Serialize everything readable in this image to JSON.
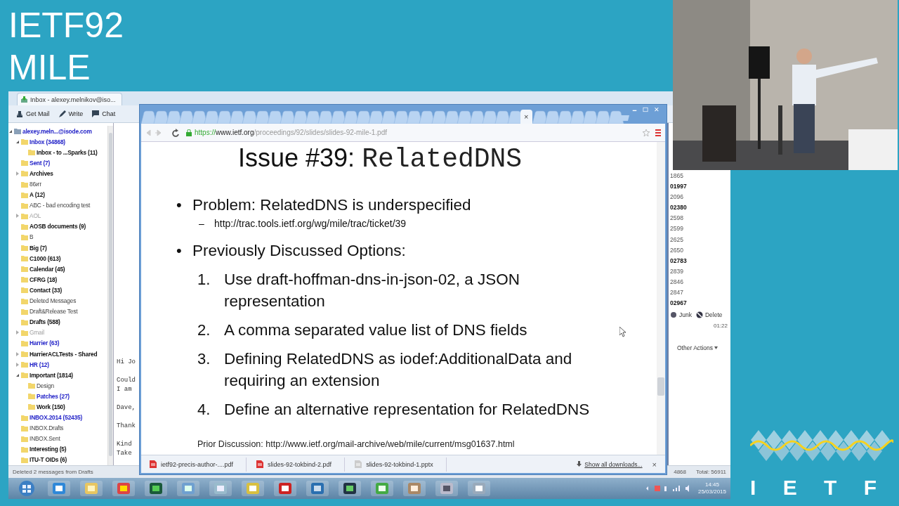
{
  "title_lines": [
    "IETF92",
    "MILE"
  ],
  "mail": {
    "tab_title": "Inbox - alexey.melnikov@iso...",
    "toolbar": [
      {
        "kind": "getmail",
        "label": "Get Mail"
      },
      {
        "kind": "write",
        "label": "Write"
      },
      {
        "kind": "chat",
        "label": "Chat"
      }
    ],
    "folders": [
      {
        "label": "alexey.meln...@isode.com",
        "unread": true,
        "new": true,
        "dimmed": false,
        "expanded": true,
        "children": [
          {
            "label": "Inbox (34868)",
            "unread": true,
            "new": true,
            "dimmed": false,
            "expanded": true,
            "children": [
              {
                "label": "Inbox - to ...Sparks (11)",
                "unread": true,
                "new": false,
                "dimmed": false
              }
            ]
          },
          {
            "label": "Sent (7)",
            "unread": true,
            "new": true,
            "dimmed": false
          },
          {
            "label": "Archives",
            "unread": true,
            "new": false,
            "dimmed": false,
            "expanded": false
          },
          {
            "label": "86ит",
            "unread": false,
            "new": false,
            "dimmed": false
          },
          {
            "label": "A (12)",
            "unread": true,
            "new": false,
            "dimmed": false
          },
          {
            "label": "ABC - bad encoding test",
            "unread": false,
            "new": false,
            "dimmed": false
          },
          {
            "label": "AOL",
            "unread": false,
            "new": false,
            "dimmed": true,
            "expanded": false
          },
          {
            "label": "AOSB documents (9)",
            "unread": true,
            "new": false,
            "dimmed": false
          },
          {
            "label": "B",
            "unread": false,
            "new": false,
            "dimmed": false
          },
          {
            "label": "Big (7)",
            "unread": true,
            "new": false,
            "dimmed": false
          },
          {
            "label": "C1000 (613)",
            "unread": true,
            "new": false,
            "dimmed": false
          },
          {
            "label": "Calendar (45)",
            "unread": true,
            "new": false,
            "dimmed": false
          },
          {
            "label": "CFRG (18)",
            "unread": true,
            "new": false,
            "dimmed": false
          },
          {
            "label": "Contact (33)",
            "unread": true,
            "new": false,
            "dimmed": false
          },
          {
            "label": "Deleted Messages",
            "unread": false,
            "new": false,
            "dimmed": false
          },
          {
            "label": "Draft&Release Test",
            "unread": false,
            "new": false,
            "dimmed": false
          },
          {
            "label": "Drafts (588)",
            "unread": true,
            "new": false,
            "dimmed": false
          },
          {
            "label": "Gmail",
            "unread": false,
            "new": false,
            "dimmed": true,
            "expanded": false
          },
          {
            "label": "Harrier (63)",
            "unread": true,
            "new": true,
            "dimmed": false
          },
          {
            "label": "HarrierACLTests - Shared",
            "unread": true,
            "new": false,
            "dimmed": false,
            "expanded": false
          },
          {
            "label": "HR (12)",
            "unread": true,
            "new": true,
            "dimmed": false,
            "expanded": false
          },
          {
            "label": "Important (1814)",
            "unread": true,
            "new": false,
            "dimmed": false,
            "expanded": true,
            "children": [
              {
                "label": "Design",
                "unread": false,
                "new": false,
                "dimmed": false
              },
              {
                "label": "Patches (27)",
                "unread": true,
                "new": true,
                "dimmed": false
              },
              {
                "label": "Work (150)",
                "unread": true,
                "new": false,
                "dimmed": false
              }
            ]
          },
          {
            "label": "INBOX.2014 (52435)",
            "unread": true,
            "new": true,
            "dimmed": false
          },
          {
            "label": "INBOX.Drafts",
            "unread": false,
            "new": false,
            "dimmed": false
          },
          {
            "label": "INBOX.Sent",
            "unread": false,
            "new": false,
            "dimmed": false
          },
          {
            "label": "Interesting (5)",
            "unread": true,
            "new": false,
            "dimmed": false
          },
          {
            "label": "ITU-T OIDs (6)",
            "unread": true,
            "new": false,
            "dimmed": false
          }
        ]
      }
    ],
    "preview": [
      [
        "Hi Jo"
      ],
      [
        "Could",
        "I am"
      ],
      [
        "Dave,"
      ],
      [
        "Thank"
      ],
      [
        "Kind",
        "Take"
      ]
    ],
    "messages": [
      {
        "text": "1865",
        "unread": false
      },
      {
        "text": "01997",
        "unread": true
      },
      {
        "text": "2096",
        "unread": false
      },
      {
        "text": "02380",
        "unread": true
      },
      {
        "text": "2598",
        "unread": false
      },
      {
        "text": "2599",
        "unread": false
      },
      {
        "text": "2625",
        "unread": false
      },
      {
        "text": "2650",
        "unread": false
      },
      {
        "text": "02783",
        "unread": true
      },
      {
        "text": "2839",
        "unread": false
      },
      {
        "text": "2846",
        "unread": false
      },
      {
        "text": "2847",
        "unread": false
      },
      {
        "text": "02967",
        "unread": true
      }
    ],
    "actions": [
      {
        "kind": "junk",
        "label": "Junk"
      },
      {
        "kind": "delete",
        "label": "Delete"
      }
    ],
    "time": "01:22",
    "other_actions": "Other Actions",
    "status_text": "Deleted 2 messages from Drafts",
    "status_count": "4868",
    "status_total": "Total: 56911"
  },
  "browser": {
    "tab_close": "×",
    "url_scheme": "https://",
    "url_host": "www.ietf.org",
    "url_path": "/proceedings/92/slides/slides-92-mile-1.pdf",
    "slide": {
      "title": "Issue #39:",
      "title_code": "RelatedDNS",
      "items": [
        {
          "kind": "bullet",
          "marker": "•",
          "text": "Problem: RelatedDNS is underspecified"
        },
        {
          "kind": "sub",
          "marker": "–",
          "text": "http://trac.tools.ietf.org/wg/mile/trac/ticket/39"
        },
        {
          "kind": "bullet",
          "marker": "•",
          "text": "Previously Discussed Options:"
        },
        {
          "kind": "number",
          "marker": "1.",
          "text": "Use draft-hoffman-dns-in-json-02, a JSON representation"
        },
        {
          "kind": "number",
          "marker": "2.",
          "text": "A comma separated value list of DNS fields"
        },
        {
          "kind": "number",
          "marker": "3.",
          "text": "Defining RelatedDNS as iodef:AdditionalData and requiring an extension"
        },
        {
          "kind": "number",
          "marker": "4.",
          "text": "Define an alternative representation for RelatedDNS"
        }
      ],
      "footer": "Prior Discussion: http://www.ietf.org/mail-archive/web/mile/current/msg01637.html"
    },
    "downloads": [
      "ietf92-precis-author-....pdf",
      "slides-92-tokbind-2.pdf",
      "slides-92-tokbind-1.pptx"
    ],
    "show_all": "Show all downloads...",
    "shelf_close": "×"
  },
  "clock": {
    "time": "14:45",
    "date": "25/03/2015"
  },
  "logo": "I E T F"
}
